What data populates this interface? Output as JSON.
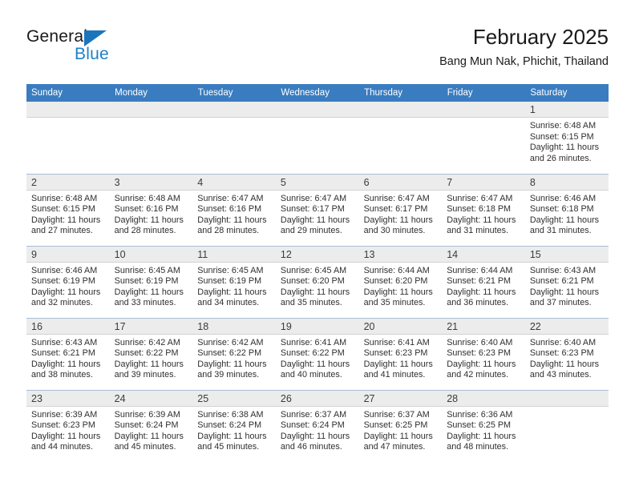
{
  "brand": {
    "name_top": "General",
    "name_bottom": "Blue",
    "accent_color": "#1b75bb",
    "blue_text_color": "#2081c7"
  },
  "header": {
    "title": "February 2025",
    "subtitle": "Bang Mun Nak, Phichit, Thailand"
  },
  "calendar": {
    "header_bg": "#3a7cc0",
    "daynum_bg": "#ececec",
    "weekday_headers": [
      "Sunday",
      "Monday",
      "Tuesday",
      "Wednesday",
      "Thursday",
      "Friday",
      "Saturday"
    ],
    "weeks": [
      [
        {
          "day": "",
          "blank": true
        },
        {
          "day": "",
          "blank": true
        },
        {
          "day": "",
          "blank": true
        },
        {
          "day": "",
          "blank": true
        },
        {
          "day": "",
          "blank": true
        },
        {
          "day": "",
          "blank": true
        },
        {
          "day": "1",
          "sunrise": "Sunrise: 6:48 AM",
          "sunset": "Sunset: 6:15 PM",
          "daylight": "Daylight: 11 hours and 26 minutes."
        }
      ],
      [
        {
          "day": "2",
          "sunrise": "Sunrise: 6:48 AM",
          "sunset": "Sunset: 6:15 PM",
          "daylight": "Daylight: 11 hours and 27 minutes."
        },
        {
          "day": "3",
          "sunrise": "Sunrise: 6:48 AM",
          "sunset": "Sunset: 6:16 PM",
          "daylight": "Daylight: 11 hours and 28 minutes."
        },
        {
          "day": "4",
          "sunrise": "Sunrise: 6:47 AM",
          "sunset": "Sunset: 6:16 PM",
          "daylight": "Daylight: 11 hours and 28 minutes."
        },
        {
          "day": "5",
          "sunrise": "Sunrise: 6:47 AM",
          "sunset": "Sunset: 6:17 PM",
          "daylight": "Daylight: 11 hours and 29 minutes."
        },
        {
          "day": "6",
          "sunrise": "Sunrise: 6:47 AM",
          "sunset": "Sunset: 6:17 PM",
          "daylight": "Daylight: 11 hours and 30 minutes."
        },
        {
          "day": "7",
          "sunrise": "Sunrise: 6:47 AM",
          "sunset": "Sunset: 6:18 PM",
          "daylight": "Daylight: 11 hours and 31 minutes."
        },
        {
          "day": "8",
          "sunrise": "Sunrise: 6:46 AM",
          "sunset": "Sunset: 6:18 PM",
          "daylight": "Daylight: 11 hours and 31 minutes."
        }
      ],
      [
        {
          "day": "9",
          "sunrise": "Sunrise: 6:46 AM",
          "sunset": "Sunset: 6:19 PM",
          "daylight": "Daylight: 11 hours and 32 minutes."
        },
        {
          "day": "10",
          "sunrise": "Sunrise: 6:45 AM",
          "sunset": "Sunset: 6:19 PM",
          "daylight": "Daylight: 11 hours and 33 minutes."
        },
        {
          "day": "11",
          "sunrise": "Sunrise: 6:45 AM",
          "sunset": "Sunset: 6:19 PM",
          "daylight": "Daylight: 11 hours and 34 minutes."
        },
        {
          "day": "12",
          "sunrise": "Sunrise: 6:45 AM",
          "sunset": "Sunset: 6:20 PM",
          "daylight": "Daylight: 11 hours and 35 minutes."
        },
        {
          "day": "13",
          "sunrise": "Sunrise: 6:44 AM",
          "sunset": "Sunset: 6:20 PM",
          "daylight": "Daylight: 11 hours and 35 minutes."
        },
        {
          "day": "14",
          "sunrise": "Sunrise: 6:44 AM",
          "sunset": "Sunset: 6:21 PM",
          "daylight": "Daylight: 11 hours and 36 minutes."
        },
        {
          "day": "15",
          "sunrise": "Sunrise: 6:43 AM",
          "sunset": "Sunset: 6:21 PM",
          "daylight": "Daylight: 11 hours and 37 minutes."
        }
      ],
      [
        {
          "day": "16",
          "sunrise": "Sunrise: 6:43 AM",
          "sunset": "Sunset: 6:21 PM",
          "daylight": "Daylight: 11 hours and 38 minutes."
        },
        {
          "day": "17",
          "sunrise": "Sunrise: 6:42 AM",
          "sunset": "Sunset: 6:22 PM",
          "daylight": "Daylight: 11 hours and 39 minutes."
        },
        {
          "day": "18",
          "sunrise": "Sunrise: 6:42 AM",
          "sunset": "Sunset: 6:22 PM",
          "daylight": "Daylight: 11 hours and 39 minutes."
        },
        {
          "day": "19",
          "sunrise": "Sunrise: 6:41 AM",
          "sunset": "Sunset: 6:22 PM",
          "daylight": "Daylight: 11 hours and 40 minutes."
        },
        {
          "day": "20",
          "sunrise": "Sunrise: 6:41 AM",
          "sunset": "Sunset: 6:23 PM",
          "daylight": "Daylight: 11 hours and 41 minutes."
        },
        {
          "day": "21",
          "sunrise": "Sunrise: 6:40 AM",
          "sunset": "Sunset: 6:23 PM",
          "daylight": "Daylight: 11 hours and 42 minutes."
        },
        {
          "day": "22",
          "sunrise": "Sunrise: 6:40 AM",
          "sunset": "Sunset: 6:23 PM",
          "daylight": "Daylight: 11 hours and 43 minutes."
        }
      ],
      [
        {
          "day": "23",
          "sunrise": "Sunrise: 6:39 AM",
          "sunset": "Sunset: 6:23 PM",
          "daylight": "Daylight: 11 hours and 44 minutes."
        },
        {
          "day": "24",
          "sunrise": "Sunrise: 6:39 AM",
          "sunset": "Sunset: 6:24 PM",
          "daylight": "Daylight: 11 hours and 45 minutes."
        },
        {
          "day": "25",
          "sunrise": "Sunrise: 6:38 AM",
          "sunset": "Sunset: 6:24 PM",
          "daylight": "Daylight: 11 hours and 45 minutes."
        },
        {
          "day": "26",
          "sunrise": "Sunrise: 6:37 AM",
          "sunset": "Sunset: 6:24 PM",
          "daylight": "Daylight: 11 hours and 46 minutes."
        },
        {
          "day": "27",
          "sunrise": "Sunrise: 6:37 AM",
          "sunset": "Sunset: 6:25 PM",
          "daylight": "Daylight: 11 hours and 47 minutes."
        },
        {
          "day": "28",
          "sunrise": "Sunrise: 6:36 AM",
          "sunset": "Sunset: 6:25 PM",
          "daylight": "Daylight: 11 hours and 48 minutes."
        },
        {
          "day": "",
          "blank": true
        }
      ]
    ]
  }
}
